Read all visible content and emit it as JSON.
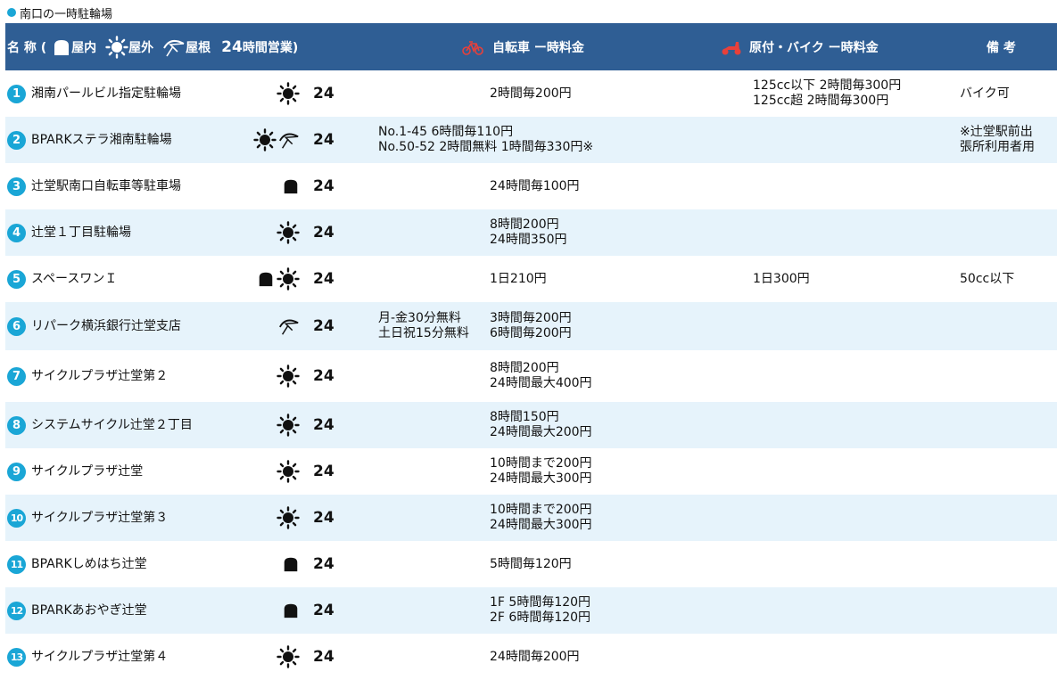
{
  "section": {
    "title": "南口の一時駐輪場"
  },
  "header": {
    "name": "名 称 (",
    "indoor": "屋内",
    "outdoor": "屋外",
    "roof": "屋根",
    "hours_num": "24",
    "hours_label": "時間営業)",
    "bicycle": "自転車 ー時料金",
    "moped": "原付・バイク ー時料金",
    "notes": "備 考"
  },
  "rows": [
    {
      "no": "1",
      "name": "湘南パールビル指定駐輪場",
      "icons": [
        "sun"
      ],
      "hours": "24",
      "bike_left": [],
      "bike": [
        "2時間毎200円"
      ],
      "moped": [
        "125cc以下 2時間毎300円",
        "125cc超 2時間毎300円"
      ],
      "notes": [
        "バイク可"
      ]
    },
    {
      "no": "2",
      "name": "BPARKステラ湘南駐輪場",
      "icons": [
        "sun",
        "roof"
      ],
      "hours": "24",
      "bike_left": [
        "No.1-45 6時間毎110円",
        "No.50-52 2時間無料 1時間毎330円※"
      ],
      "bike": [],
      "moped": [],
      "notes": [
        "※辻堂駅前出",
        "張所利用者用"
      ]
    },
    {
      "no": "3",
      "name": "辻堂駅南口自転車等駐車場",
      "icons": [
        "indoor"
      ],
      "hours": "24",
      "bike_left": [],
      "bike": [
        "24時間毎100円"
      ],
      "moped": [],
      "notes": []
    },
    {
      "no": "4",
      "name": "辻堂１丁目駐輪場",
      "icons": [
        "sun"
      ],
      "hours": "24",
      "bike_left": [],
      "bike": [
        "8時間200円",
        "24時間350円"
      ],
      "moped": [],
      "notes": []
    },
    {
      "no": "5",
      "name": "スペースワンＩ",
      "icons": [
        "indoor",
        "sun"
      ],
      "hours": "24",
      "bike_left": [],
      "bike": [
        "1日210円"
      ],
      "moped": [
        "1日300円"
      ],
      "notes": [
        "50cc以下"
      ]
    },
    {
      "no": "6",
      "name": "リパーク横浜銀行辻堂支店",
      "icons": [
        "roof"
      ],
      "hours": "24",
      "bike_left": [
        "月-金30分無料",
        "土日祝15分無料"
      ],
      "bike": [
        "3時間毎200円",
        "6時間毎200円"
      ],
      "moped": [],
      "notes": []
    },
    {
      "no": "7",
      "name": "サイクルプラザ辻堂第２",
      "icons": [
        "sun"
      ],
      "hours": "24",
      "bike_left": [],
      "bike": [
        "8時間200円",
        "24時間最大400円"
      ],
      "moped": [],
      "notes": []
    },
    {
      "no": "8",
      "name": "システムサイクル辻堂２丁目",
      "icons": [
        "sun"
      ],
      "hours": "24",
      "bike_left": [],
      "bike": [
        "8時間150円",
        "24時間最大200円"
      ],
      "moped": [],
      "notes": []
    },
    {
      "no": "9",
      "name": "サイクルプラザ辻堂",
      "icons": [
        "sun"
      ],
      "hours": "24",
      "bike_left": [],
      "bike": [
        "10時間まで200円",
        "24時間最大300円"
      ],
      "moped": [],
      "notes": []
    },
    {
      "no": "10",
      "name": "サイクルプラザ辻堂第３",
      "icons": [
        "sun"
      ],
      "hours": "24",
      "bike_left": [],
      "bike": [
        "10時間まで200円",
        "24時間最大300円"
      ],
      "moped": [],
      "notes": []
    },
    {
      "no": "11",
      "name": "BPARKしめはち辻堂",
      "icons": [
        "indoor"
      ],
      "hours": "24",
      "bike_left": [],
      "bike": [
        "5時間毎120円"
      ],
      "moped": [],
      "notes": []
    },
    {
      "no": "12",
      "name": "BPARKあおやぎ辻堂",
      "icons": [
        "indoor"
      ],
      "hours": "24",
      "bike_left": [],
      "bike": [
        "1F 5時間毎120円",
        "2F 6時間毎120円"
      ],
      "moped": [],
      "notes": []
    },
    {
      "no": "13",
      "name": "サイクルプラザ辻堂第４",
      "icons": [
        "sun"
      ],
      "hours": "24",
      "bike_left": [],
      "bike": [
        "24時間毎200円"
      ],
      "moped": [],
      "notes": []
    }
  ]
}
